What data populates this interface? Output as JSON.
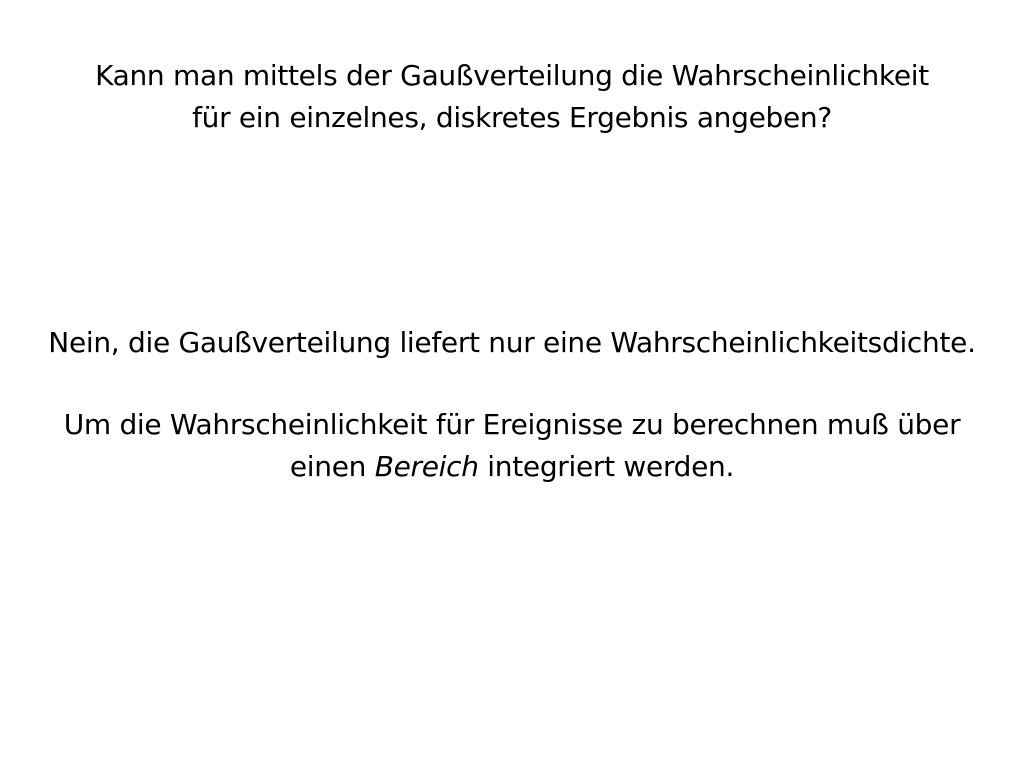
{
  "slide": {
    "question": {
      "line1": "Kann man mittels der Gaußverteilung die Wahrscheinlichkeit",
      "line2": "für ein einzelnes, diskretes Ergebnis angeben?"
    },
    "answer": {
      "paragraph1": "Nein, die Gaußverteilung liefert nur eine Wahrscheinlichkeitsdichte.",
      "paragraph2_line1": "Um die Wahrscheinlichkeit für Ereignisse zu berechnen muß über",
      "paragraph2_before_emphasis": "einen ",
      "paragraph2_emphasis": "Bereich",
      "paragraph2_after_emphasis": " integriert werden."
    }
  }
}
